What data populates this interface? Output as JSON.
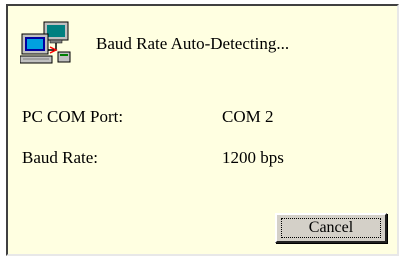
{
  "dialog": {
    "title": "Baud Rate Auto-Detecting...",
    "icon": "network-computers-icon"
  },
  "fields": {
    "port_label": "PC COM Port:",
    "port_value": "COM 2",
    "baud_label": "Baud Rate:",
    "baud_value": "1200 bps"
  },
  "buttons": {
    "cancel_label": "Cancel"
  },
  "colors": {
    "dialog_background": "#ffffe1",
    "button_face": "#d4d0c8"
  }
}
